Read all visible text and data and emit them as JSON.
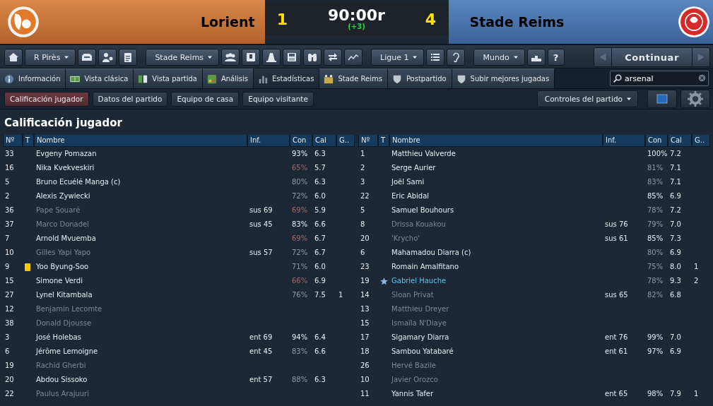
{
  "match": {
    "home_team": "Lorient",
    "home_score": "1",
    "clock": "90:00r",
    "added_time": "(+3)",
    "away_score": "4",
    "away_team": "Stade Reims"
  },
  "toolbar": [
    {
      "kind": "icon"
    },
    {
      "kind": "dropdown",
      "label": "R Pirès"
    },
    {
      "kind": "icon"
    },
    {
      "kind": "icon"
    },
    {
      "kind": "icon"
    },
    {
      "kind": "dropdown",
      "label": "Stade Reims"
    },
    {
      "kind": "icon"
    },
    {
      "kind": "icon"
    },
    {
      "kind": "icon"
    },
    {
      "kind": "icon"
    },
    {
      "kind": "icon"
    },
    {
      "kind": "icon"
    },
    {
      "kind": "icon"
    },
    {
      "kind": "dropdown",
      "label": "Ligue 1"
    },
    {
      "kind": "icon"
    },
    {
      "kind": "icon"
    },
    {
      "kind": "dropdown",
      "label": "Mundo"
    },
    {
      "kind": "icon"
    },
    {
      "kind": "text",
      "label": "?"
    }
  ],
  "continue_button": "Continuar",
  "tabs": [
    {
      "label": "Información",
      "selected": false
    },
    {
      "label": "Vista clásica",
      "selected": false
    },
    {
      "label": "Vista partida",
      "selected": false
    },
    {
      "label": "Análisis",
      "selected": false
    },
    {
      "label": "Estadísticas",
      "selected": true
    },
    {
      "label": "Stade Reims",
      "selected": false
    },
    {
      "label": "Postpartido",
      "selected": false
    },
    {
      "label": "Subir mejores jugadas",
      "selected": false
    }
  ],
  "search": {
    "value": "arsenal"
  },
  "subtabs": [
    {
      "label": "Calificación jugador",
      "selected": true
    },
    {
      "label": "Datos del partido",
      "selected": false
    },
    {
      "label": "Equipo de casa",
      "selected": false
    },
    {
      "label": "Equipo visitante",
      "selected": false
    }
  ],
  "match_controls": "Controles del partido",
  "section_title": "Calificación jugador",
  "tables": [
    {
      "columns": [
        "Nº",
        "T",
        "Nombre",
        "Inf.",
        "Con",
        "Cal",
        "G.."
      ],
      "rows": [
        {
          "kind": "player",
          "num": "33",
          "name": "Evgeny Pomazan",
          "con": "93%",
          "color": "#e8ecef",
          "cal": "6.3",
          "active": true
        },
        {
          "kind": "player",
          "num": "16",
          "name": "Nika Kvekveskiri",
          "con": "65%",
          "color": "#a06a6a",
          "cal": "5.7",
          "active": true
        },
        {
          "kind": "player",
          "num": "5",
          "name": "Bruno Ecuélé Manga (c)",
          "con": "80%",
          "color": "#8f98a3",
          "cal": "6.3",
          "active": true
        },
        {
          "kind": "player",
          "num": "2",
          "name": "Alexis Zywiecki",
          "con": "72%",
          "color": "#8f98a3",
          "cal": "6.0",
          "active": true
        },
        {
          "kind": "player",
          "num": "36",
          "name": "Pape Souaré",
          "inf": "sus 69",
          "con": "69%",
          "color": "#a06a6a",
          "cal": "5.9",
          "active": false
        },
        {
          "kind": "player",
          "num": "37",
          "name": "Marco Donadel",
          "inf": "sus 45",
          "con": "83%",
          "color": "#e8ecef",
          "cal": "6.6",
          "active": false
        },
        {
          "kind": "player",
          "num": "7",
          "name": "Arnold Mvuemba",
          "con": "69%",
          "color": "#a06a6a",
          "cal": "6.7",
          "active": true
        },
        {
          "kind": "player",
          "num": "10",
          "name": "Gilles Yapi Yapo",
          "inf": "sus 57",
          "con": "72%",
          "color": "#8f98a3",
          "cal": "6.7",
          "active": false
        },
        {
          "kind": "booked",
          "num": "9",
          "name": "Yoo Byung-Soo",
          "con": "71%",
          "color": "#8f98a3",
          "cal": "6.0",
          "active": true
        },
        {
          "kind": "player",
          "num": "15",
          "name": "Simone Verdi",
          "con": "66%",
          "color": "#a06a6a",
          "cal": "6.9",
          "active": true
        },
        {
          "kind": "player",
          "num": "27",
          "name": "Lynel Kitambala",
          "con": "76%",
          "color": "#8f98a3",
          "cal": "7.5",
          "goals": "1",
          "active": true
        },
        {
          "kind": "player",
          "num": "12",
          "name": "Benjamin Lecomte",
          "active": false
        },
        {
          "kind": "player",
          "num": "38",
          "name": "Donald Djousse",
          "active": false
        },
        {
          "kind": "player",
          "num": "3",
          "name": "José Holebas",
          "inf": "ent 69",
          "con": "94%",
          "color": "#e8ecef",
          "cal": "6.4",
          "active": true
        },
        {
          "kind": "player",
          "num": "6",
          "name": "Jérôme Lemoigne",
          "inf": "ent 45",
          "con": "83%",
          "color": "#8f98a3",
          "cal": "6.6",
          "active": true
        },
        {
          "kind": "player",
          "num": "19",
          "name": "Rachid Gherbi",
          "active": false
        },
        {
          "kind": "player",
          "num": "20",
          "name": "Abdou Sissoko",
          "inf": "ent 57",
          "con": "88%",
          "color": "#8f98a3",
          "cal": "6.3",
          "active": true
        },
        {
          "kind": "player",
          "num": "22",
          "name": "Paulus Arajuuri",
          "active": false
        }
      ]
    },
    {
      "columns": [
        "Nº",
        "T",
        "Nombre",
        "Inf.",
        "Con",
        "Cal",
        "G.."
      ],
      "rows": [
        {
          "kind": "player",
          "num": "1",
          "name": "Matthieu Valverde",
          "con": "100%",
          "color": "#e8ecef",
          "cal": "7.2",
          "active": true
        },
        {
          "kind": "player",
          "num": "2",
          "name": "Serge Aurier",
          "con": "81%",
          "color": "#8f98a3",
          "cal": "7.1",
          "active": true
        },
        {
          "kind": "player",
          "num": "3",
          "name": "Joël Sami",
          "con": "83%",
          "color": "#8f98a3",
          "cal": "7.1",
          "active": true
        },
        {
          "kind": "player",
          "num": "22",
          "name": "Eric Abidal",
          "con": "85%",
          "color": "#e8ecef",
          "cal": "6.9",
          "active": true
        },
        {
          "kind": "player",
          "num": "5",
          "name": "Samuel Bouhours",
          "con": "78%",
          "color": "#8f98a3",
          "cal": "7.2",
          "active": true
        },
        {
          "kind": "player",
          "num": "8",
          "name": "Drissa Kouakou",
          "inf": "sus 76",
          "con": "79%",
          "color": "#8f98a3",
          "cal": "7.0",
          "active": false
        },
        {
          "kind": "player",
          "num": "20",
          "name": "'Krycho'",
          "inf": "sus 61",
          "con": "85%",
          "color": "#e8ecef",
          "cal": "7.3",
          "active": false
        },
        {
          "kind": "player",
          "num": "6",
          "name": "Mahamadou Diarra (c)",
          "con": "80%",
          "color": "#8f98a3",
          "cal": "6.9",
          "active": true
        },
        {
          "kind": "player",
          "num": "23",
          "name": "Romain Amalfitano",
          "con": "75%",
          "color": "#8f98a3",
          "cal": "8.0",
          "goals": "1",
          "active": true
        },
        {
          "kind": "motm",
          "num": "19",
          "name": "Gabriel Hauche",
          "con": "78%",
          "color": "#8f98a3",
          "cal": "9.3",
          "goals": "2",
          "active": true
        },
        {
          "kind": "player",
          "num": "14",
          "name": "Sloan Privat",
          "inf": "sus 65",
          "con": "82%",
          "color": "#8f98a3",
          "cal": "6.8",
          "active": false
        },
        {
          "kind": "player",
          "num": "13",
          "name": "Matthieu Dreyer",
          "active": false
        },
        {
          "kind": "player",
          "num": "15",
          "name": "Ismaïla N'Diaye",
          "active": false
        },
        {
          "kind": "player",
          "num": "17",
          "name": "Sigamary Diarra",
          "inf": "ent 76",
          "con": "99%",
          "color": "#e8ecef",
          "cal": "7.0",
          "active": true
        },
        {
          "kind": "player",
          "num": "18",
          "name": "Sambou Yatabaré",
          "inf": "ent 61",
          "con": "97%",
          "color": "#e8ecef",
          "cal": "6.9",
          "active": true
        },
        {
          "kind": "player",
          "num": "26",
          "name": "Hervé Bazile",
          "active": false
        },
        {
          "kind": "player",
          "num": "10",
          "name": "Javier Orozco",
          "active": false
        },
        {
          "kind": "player",
          "num": "11",
          "name": "Yannis Tafer",
          "inf": "ent 65",
          "con": "98%",
          "color": "#e8ecef",
          "cal": "7.9",
          "goals": "1",
          "active": true
        }
      ]
    }
  ]
}
